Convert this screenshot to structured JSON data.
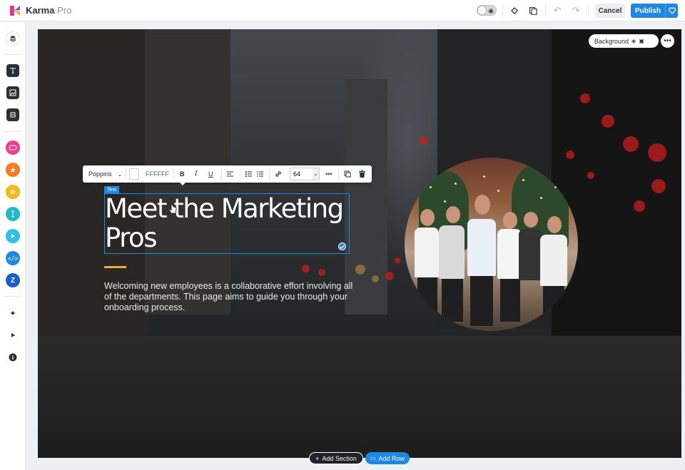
{
  "app": {
    "name": "Karma",
    "name_suffix": "Pro"
  },
  "toolbar": {
    "cancel_label": "Cancel",
    "publish_label": "Publish"
  },
  "canvas": {
    "background_label": "Background",
    "text_tag": "Text",
    "headline": "Meet the Marketing Pros",
    "body": "Welcoming new employees is a collaborative effort involving all of the departments. This page aims to guide you through your onboarding process."
  },
  "text_toolbar": {
    "font": "Poppins",
    "color_hex": "FFFFFF",
    "font_size": "64"
  },
  "bottom": {
    "add_section_label": "Add Section",
    "add_row_label": "Add Row"
  },
  "colors": {
    "accent": "#1e88e5",
    "heading_underline": "#f2a93b"
  }
}
